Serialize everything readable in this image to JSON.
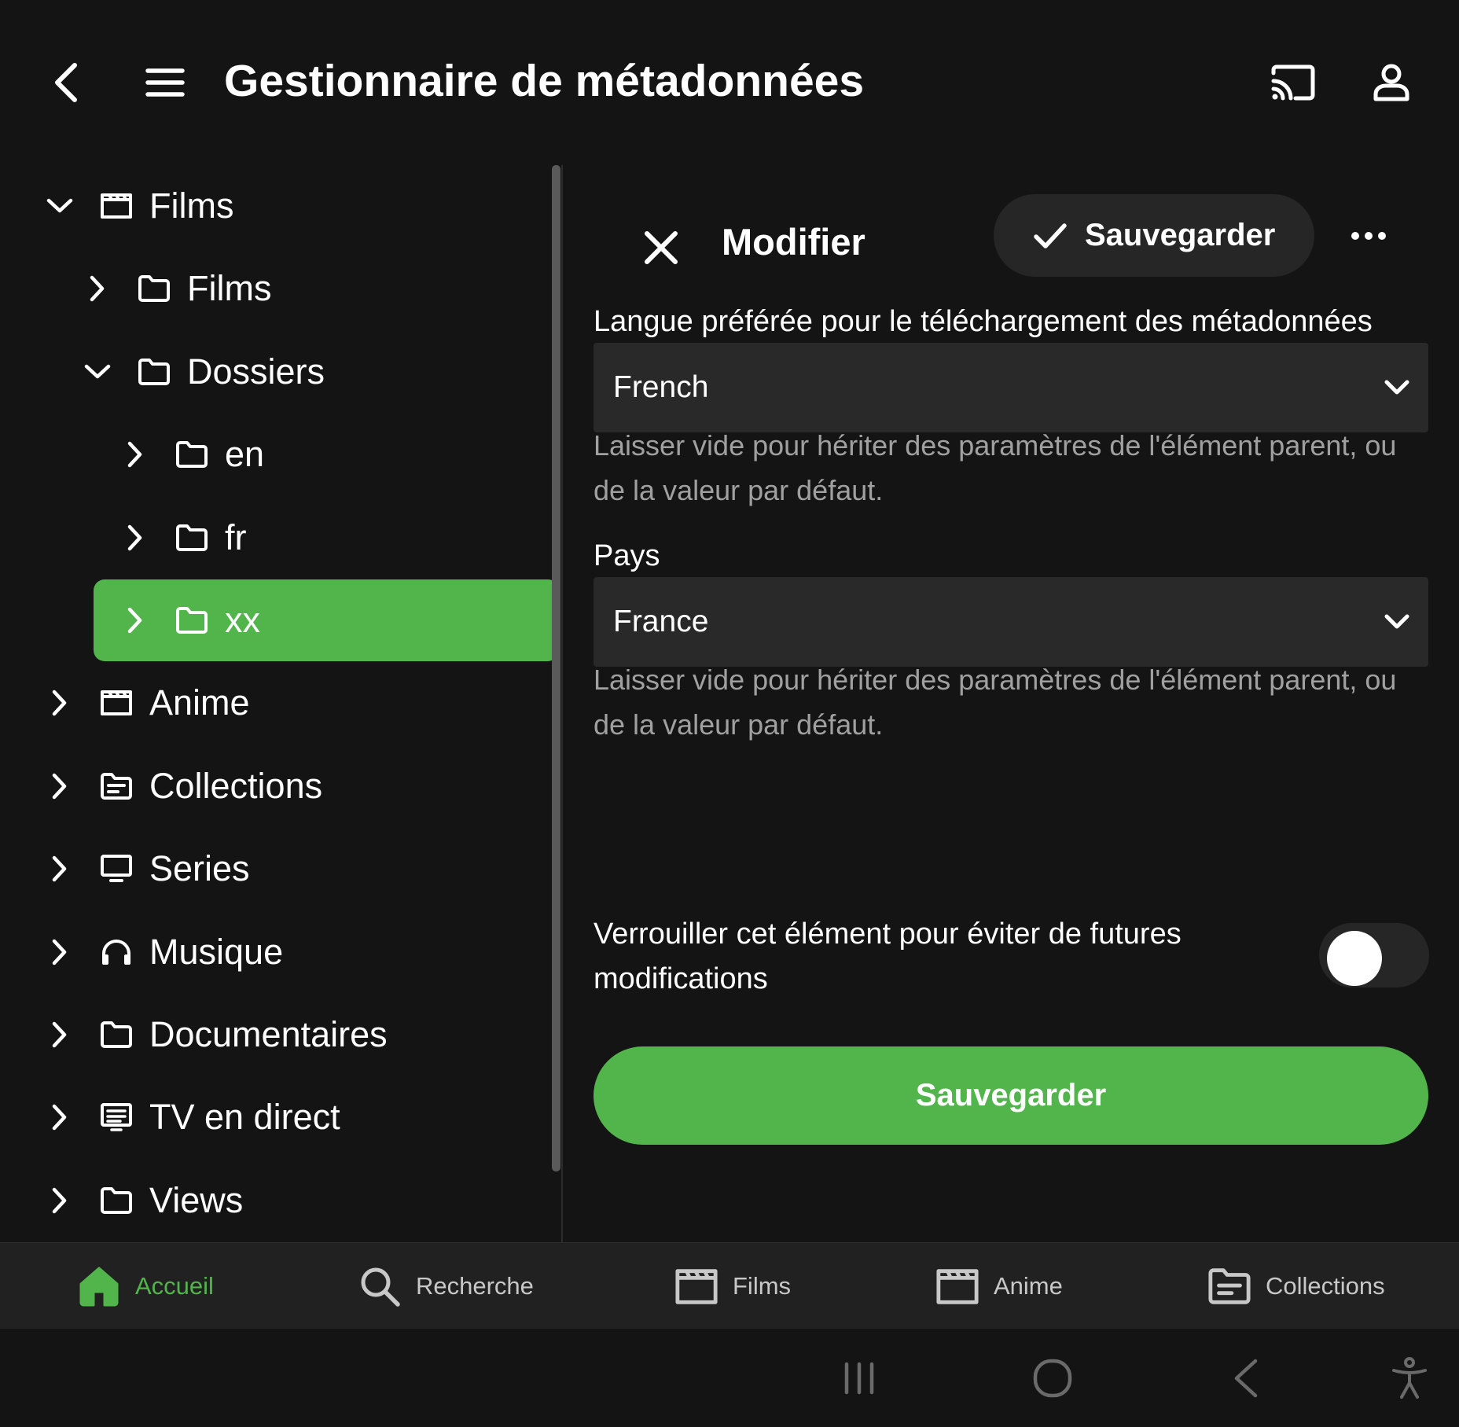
{
  "header": {
    "title": "Gestionnaire de métadonnées",
    "icons": {
      "back": "back-arrow-icon",
      "menu": "hamburger-menu-icon",
      "cast": "cast-icon",
      "user": "user-icon"
    }
  },
  "tree": {
    "items": [
      {
        "label": "Films",
        "icon": "movie-clapper-icon",
        "expanded": true,
        "level": 0
      },
      {
        "label": "Films",
        "icon": "folder-icon",
        "expanded": false,
        "level": 1
      },
      {
        "label": "Dossiers",
        "icon": "folder-icon",
        "expanded": true,
        "level": 1
      },
      {
        "label": "en",
        "icon": "folder-icon",
        "expanded": false,
        "level": 2
      },
      {
        "label": "fr",
        "icon": "folder-icon",
        "expanded": false,
        "level": 2
      },
      {
        "label": "xx",
        "icon": "folder-icon",
        "expanded": false,
        "level": 2,
        "selected": true
      },
      {
        "label": "Anime",
        "icon": "movie-clapper-icon",
        "expanded": false,
        "level": 0
      },
      {
        "label": "Collections",
        "icon": "collections-folder-icon",
        "expanded": false,
        "level": 0
      },
      {
        "label": "Series",
        "icon": "tv-icon",
        "expanded": false,
        "level": 0
      },
      {
        "label": "Musique",
        "icon": "headphones-icon",
        "expanded": false,
        "level": 0
      },
      {
        "label": "Documentaires",
        "icon": "folder-icon",
        "expanded": false,
        "level": 0
      },
      {
        "label": "TV en direct",
        "icon": "live-tv-icon",
        "expanded": false,
        "level": 0
      },
      {
        "label": "Views",
        "icon": "folder-icon",
        "expanded": false,
        "level": 0
      }
    ]
  },
  "editor": {
    "title": "Modifier",
    "save_pill_label": "Sauvegarder",
    "language": {
      "label": "Langue préférée pour le téléchargement des métadonnées",
      "value": "French",
      "help": "Laisser vide pour hériter des paramètres de l'élément parent, ou de la valeur par défaut."
    },
    "country": {
      "label": "Pays",
      "value": "France",
      "help": "Laisser vide pour hériter des paramètres de l'élément parent, ou de la valeur par défaut."
    },
    "lock": {
      "label": "Verrouiller cet élément pour éviter de futures modifications",
      "checked": false
    },
    "save_button_label": "Sauvegarder"
  },
  "bottom_nav": {
    "items": [
      {
        "label": "Accueil",
        "icon": "home-icon",
        "active": true
      },
      {
        "label": "Recherche",
        "icon": "search-icon",
        "active": false
      },
      {
        "label": "Films",
        "icon": "movie-clapper-icon",
        "active": false
      },
      {
        "label": "Anime",
        "icon": "movie-clapper-icon",
        "active": false
      },
      {
        "label": "Collections",
        "icon": "collections-folder-icon",
        "active": false
      }
    ]
  },
  "system_bar": {
    "icons": [
      "recent-apps-icon",
      "home-circle-icon",
      "system-back-icon",
      "accessibility-icon"
    ]
  },
  "colors": {
    "accent": "#52b54b",
    "background": "#141414",
    "surface": "#292929",
    "muted_text": "#a0a0a0"
  }
}
